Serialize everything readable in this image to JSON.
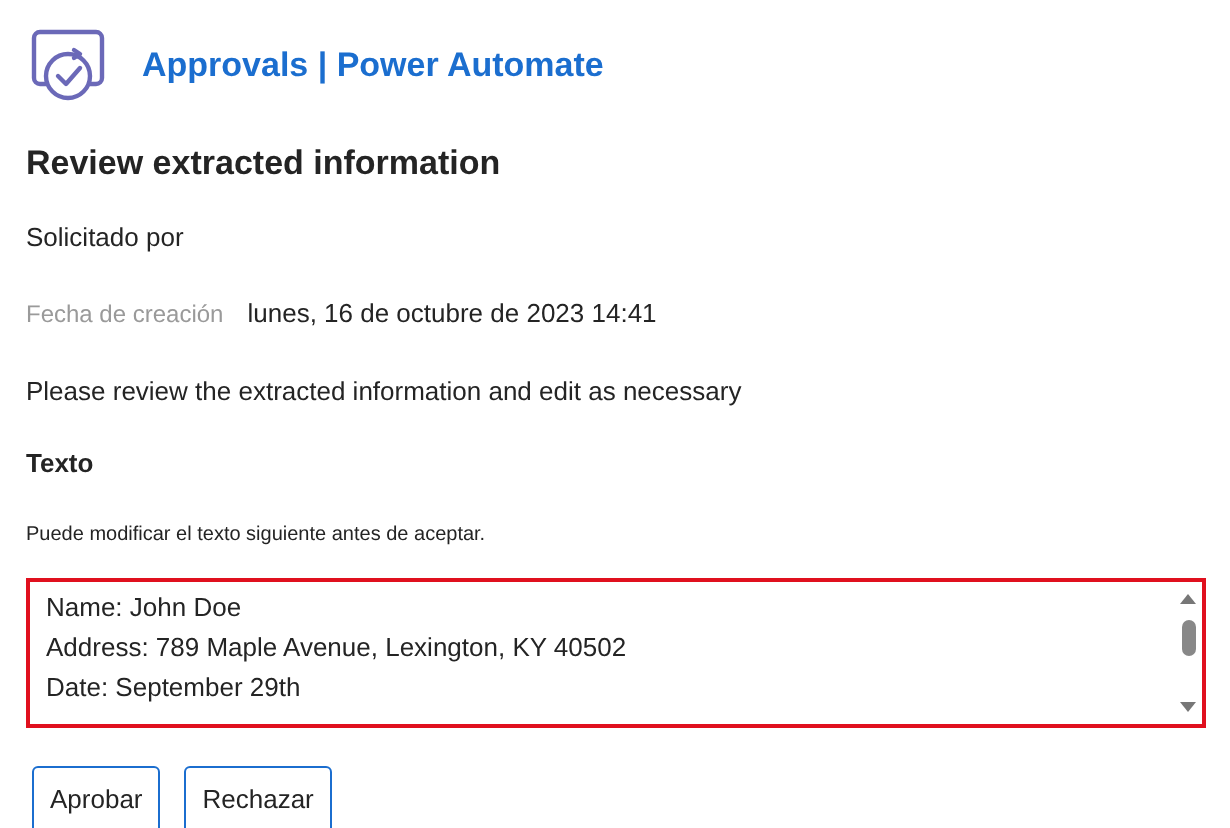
{
  "header": {
    "title": "Approvals | Power Automate"
  },
  "heading": "Review extracted information",
  "requested_by": {
    "label": "Solicitado por"
  },
  "created": {
    "label": "Fecha de creación",
    "value": "lunes, 16 de octubre de 2023 14:41"
  },
  "instructions": "Please review the extracted information and edit as necessary",
  "text_section": {
    "label": "Texto",
    "hint": "Puede modificar el texto siguiente antes de aceptar.",
    "lines": [
      "Name: John Doe",
      "Address: 789 Maple Avenue, Lexington, KY 40502",
      "Date: September 29th"
    ]
  },
  "buttons": [
    "Aprobar",
    "Rechazar"
  ]
}
